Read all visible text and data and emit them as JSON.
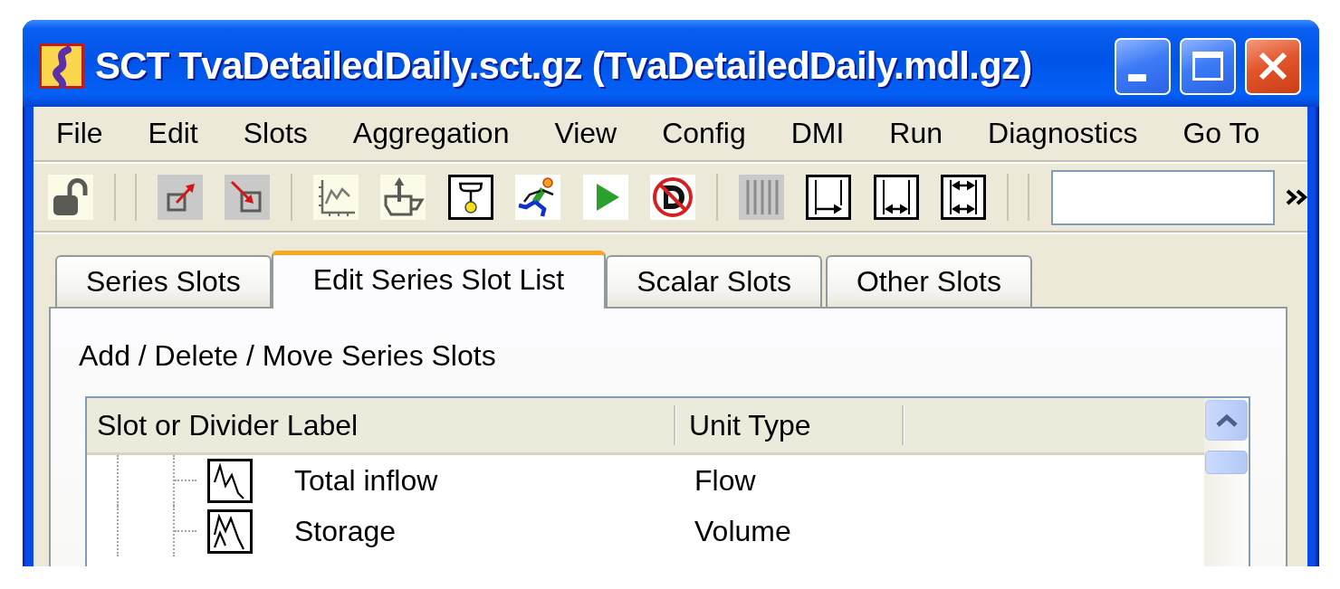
{
  "window": {
    "title": "SCT TvaDetailedDaily.sct.gz (TvaDetailedDaily.mdl.gz)"
  },
  "menu": [
    "File",
    "Edit",
    "Slots",
    "Aggregation",
    "View",
    "Config",
    "DMI",
    "Run",
    "Diagnostics",
    "Go To"
  ],
  "tabs": [
    {
      "label": "Series Slots",
      "selected": false
    },
    {
      "label": "Edit Series Slot List",
      "selected": true
    },
    {
      "label": "Scalar Slots",
      "selected": false
    },
    {
      "label": "Other Slots",
      "selected": false
    }
  ],
  "panel": {
    "heading": "Add / Delete / Move Series Slots",
    "table": {
      "columns": [
        "Slot or Divider Label",
        "Unit Type"
      ],
      "rows": [
        {
          "label": "Total inflow",
          "unit_type": "Flow"
        },
        {
          "label": "Storage",
          "unit_type": "Volume"
        }
      ]
    }
  }
}
